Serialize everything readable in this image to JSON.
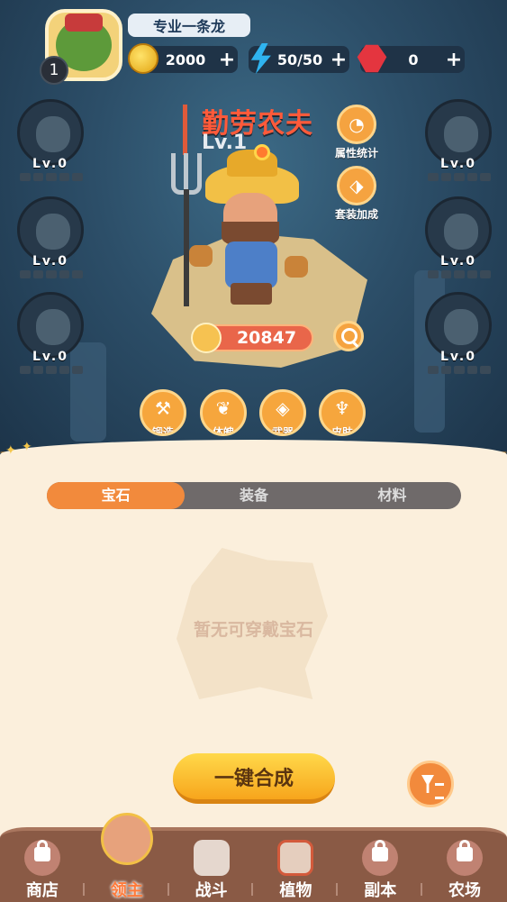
{
  "player": {
    "name": "专业一条龙",
    "level": "1"
  },
  "resources": {
    "gold": "2000",
    "energy": "50/50",
    "gems": "0"
  },
  "hero": {
    "name": "勤劳农夫",
    "level": "Lv.1",
    "power": "20847"
  },
  "equip_slots_left": [
    {
      "level": "Lv.0"
    },
    {
      "level": "Lv.0"
    },
    {
      "level": "Lv.0"
    }
  ],
  "equip_slots_right": [
    {
      "level": "Lv.0"
    },
    {
      "level": "Lv.0"
    },
    {
      "level": "Lv.0"
    }
  ],
  "side_buttons": {
    "stats": "属性统计",
    "set_bonus": "套装加成"
  },
  "craft_buttons": [
    {
      "label": "锻造",
      "icon": "hammer-icon"
    },
    {
      "label": "体魄",
      "icon": "sprout-icon"
    },
    {
      "label": "武器",
      "icon": "diamond-icon"
    },
    {
      "label": "皮肤",
      "icon": "skin-icon"
    }
  ],
  "tabs": [
    {
      "label": "宝石",
      "active": true
    },
    {
      "label": "装备",
      "active": false
    },
    {
      "label": "材料",
      "active": false
    }
  ],
  "empty_text": "暂无可穿戴宝石",
  "merge_button": "一键合成",
  "nav": [
    {
      "label": "商店",
      "locked": true
    },
    {
      "label": "领主",
      "active": true
    },
    {
      "label": "战斗",
      "locked": false
    },
    {
      "label": "植物",
      "locked": false
    },
    {
      "label": "副本",
      "locked": true
    },
    {
      "label": "农场",
      "locked": true
    }
  ],
  "colors": {
    "accent": "#f28a3c",
    "hero_name": "#ff5a3a",
    "nav_bg": "#8a5a45",
    "scene_bg": "#2c4e68"
  }
}
